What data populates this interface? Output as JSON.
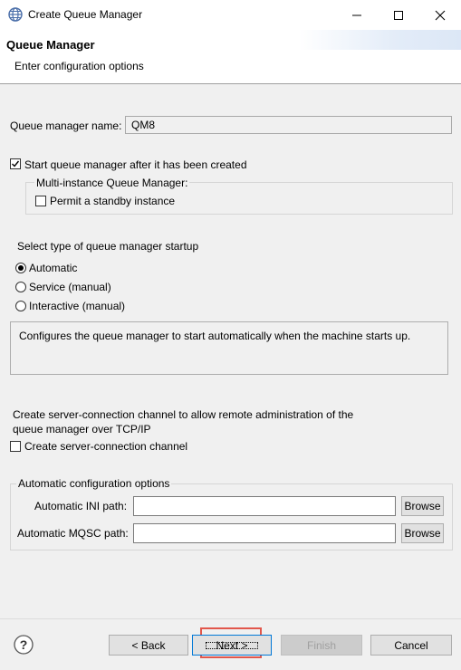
{
  "window": {
    "title": "Create Queue Manager",
    "icon": "globe-icon"
  },
  "header": {
    "title": "Queue Manager",
    "subtitle": "Enter configuration options"
  },
  "form": {
    "qm_name_label": "Queue manager name:",
    "qm_name_value": "QM8",
    "start_after_create": {
      "label": "Start queue manager after it has been created",
      "checked": true
    },
    "multi_instance_group": {
      "title": "Multi-instance Queue Manager:",
      "permit_standby": {
        "label": "Permit a standby instance",
        "checked": false
      }
    },
    "startup_type_label": "Select type of queue manager startup",
    "startup_options": [
      {
        "label": "Automatic",
        "selected": true
      },
      {
        "label": "Service (manual)",
        "selected": false
      },
      {
        "label": "Interactive (manual)",
        "selected": false
      }
    ],
    "description": "Configures the queue manager to start automatically when the machine starts up.",
    "svrconn_text_line1": "Create server-connection channel to allow remote administration of the",
    "svrconn_text_line2": "queue manager over TCP/IP",
    "create_svrconn": {
      "label": "Create server-connection channel",
      "checked": false
    },
    "auto_config_group": {
      "title": "Automatic configuration options",
      "ini_label": "Automatic INI path:",
      "ini_value": "",
      "mqsc_label": "Automatic MQSC path:",
      "mqsc_value": "",
      "browse_label": "Browse"
    }
  },
  "footer": {
    "help_icon": "help-icon",
    "back_label": "< Back",
    "next_label": "Next >",
    "finish_label": "Finish",
    "cancel_label": "Cancel"
  }
}
